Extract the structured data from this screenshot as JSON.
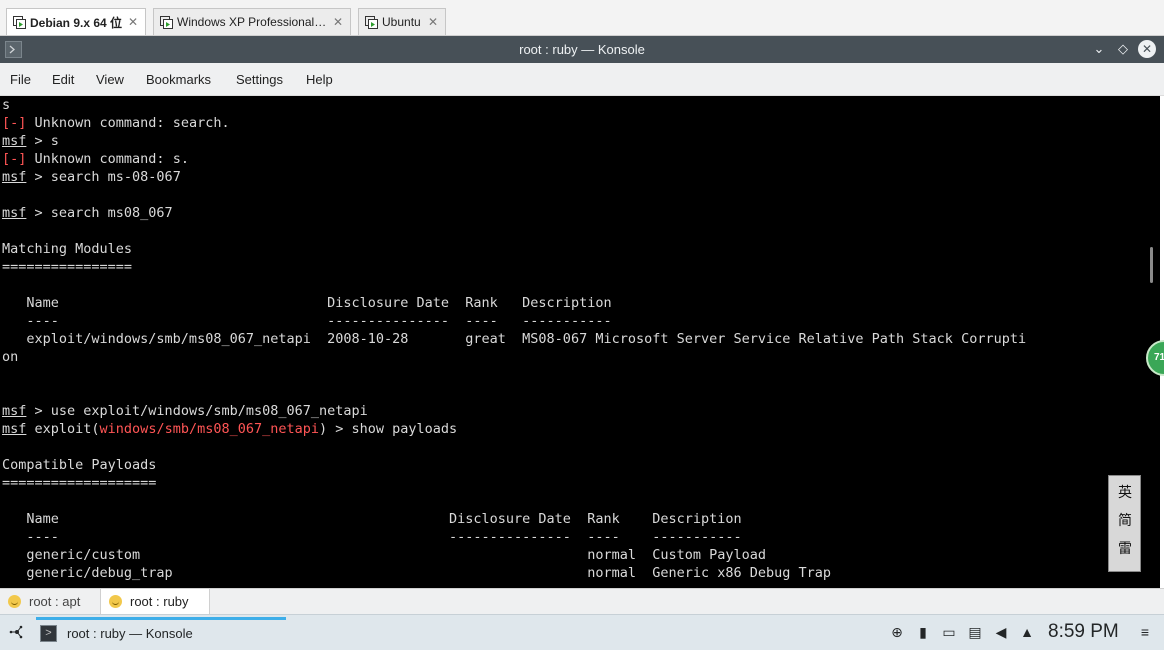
{
  "vm_tabs": [
    {
      "label": "Debian 9.x 64 位",
      "close": "✕"
    },
    {
      "label": "Windows XP Professional No P…",
      "close": "✕"
    },
    {
      "label": "Ubuntu",
      "close": "✕"
    }
  ],
  "window": {
    "title": "root : ruby — Konsole",
    "app_icon": "terminal-icon",
    "btn_min": "⌄",
    "btn_max": "◇",
    "btn_close": "✕"
  },
  "menu": [
    "File",
    "Edit",
    "View",
    "Bookmarks",
    "Settings",
    "Help"
  ],
  "terminal": {
    "l01": "s",
    "l02_tag": "[-]",
    "l02_text": " Unknown command: search.",
    "l03_prompt": "msf",
    "l03_text": " > s",
    "l04_tag": "[-]",
    "l04_text": " Unknown command: s.",
    "l05_prompt": "msf",
    "l05_text": " > search ms-08-067",
    "l07_prompt": "msf",
    "l07_text": " > search ms08_067",
    "l09": "Matching Modules",
    "l10": "================",
    "l12": "   Name                                 Disclosure Date  Rank   Description",
    "l13": "   ----                                 ---------------  ----   -----------",
    "l14": "   exploit/windows/smb/ms08_067_netapi  2008-10-28       great  MS08-067 Microsoft Server Service Relative Path Stack Corrupti",
    "l15": "on",
    "l18_prompt": "msf",
    "l18_text": " > use exploit/windows/smb/ms08_067_netapi",
    "l19_prompt": "msf",
    "l19_text_a": " exploit(",
    "l19_module": "windows/smb/ms08_067_netapi",
    "l19_text_b": ") > show payloads",
    "l21": "Compatible Payloads",
    "l22": "===================",
    "l24": "   Name                                                Disclosure Date  Rank    Description",
    "l25": "   ----                                                ---------------  ----    -----------",
    "l26": "   generic/custom                                                       normal  Custom Payload",
    "l27": "   generic/debug_trap                                                   normal  Generic x86 Debug Trap"
  },
  "watermark_chars": [
    "英",
    "简",
    "雷"
  ],
  "notification_badge": "71",
  "session_tabs": [
    {
      "label": "root : apt",
      "icon": "smiley-icon"
    },
    {
      "label": "root : ruby",
      "icon": "smiley-icon"
    }
  ],
  "taskbar": {
    "task_label": "root : ruby — Konsole",
    "clock": "8:59 PM"
  },
  "colors": {
    "terminal_bg": "#000000",
    "terminal_fg": "#d9d9d9",
    "error_red": "#ff5555",
    "titlebar": "#475057",
    "accent": "#3daee9"
  }
}
